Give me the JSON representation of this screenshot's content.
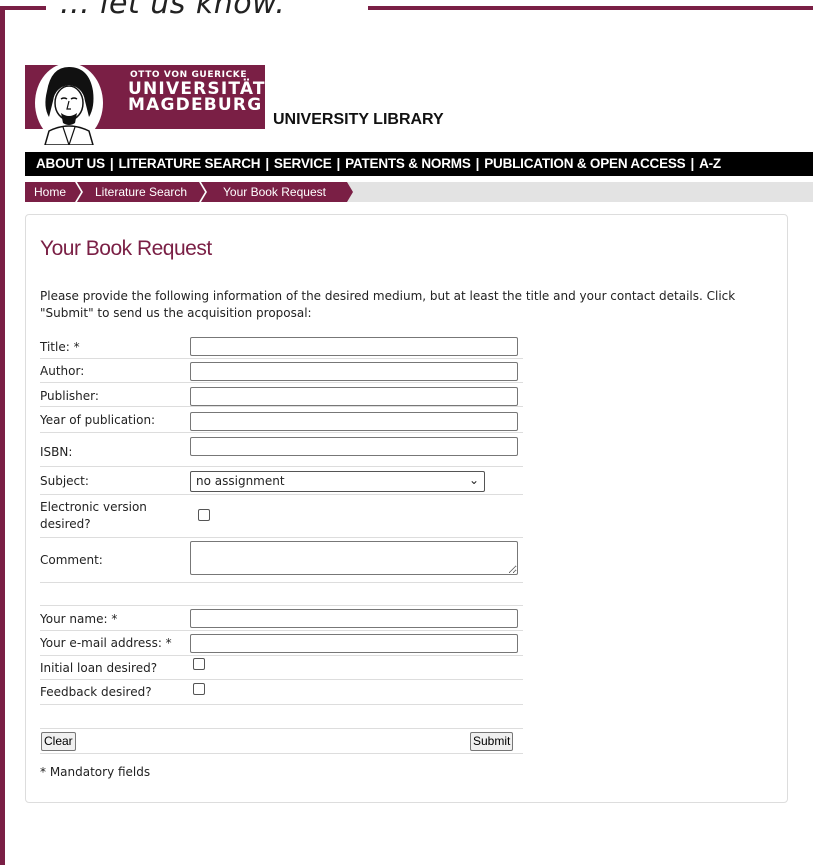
{
  "caption": "... let us know.",
  "logo": {
    "line1": "OTTO VON GUERICKE",
    "line2": "UNIVERSITÄT",
    "line3": "MAGDEBURG"
  },
  "library_title": "UNIVERSITY LIBRARY",
  "nav": [
    "ABOUT US",
    "LITERATURE SEARCH",
    "SERVICE",
    "PATENTS & NORMS",
    "PUBLICATION & OPEN ACCESS",
    "A-Z"
  ],
  "nav_separator": "|",
  "breadcrumb": [
    "Home",
    "Literature Search",
    "Your Book Request"
  ],
  "page_title": "Your Book Request",
  "intro": "Please provide the following information of the desired medium, but at least the title and your contact details. Click \"Submit\" to send us the acquisition proposal:",
  "form": {
    "title_label": "Title: *",
    "title_value": "",
    "author_label": "Author:",
    "author_value": "",
    "publisher_label": "Publisher:",
    "publisher_value": "",
    "year_label": "Year of publication:",
    "year_value": "",
    "isbn_label": "ISBN:",
    "isbn_value": "",
    "subject_label": "Subject:",
    "subject_value": "no assignment",
    "electronic_label": "Electronic version desired?",
    "electronic_checked": false,
    "comment_label": "Comment:",
    "comment_value": "",
    "name_label": "Your name: *",
    "name_value": "",
    "email_label": "Your e-mail address: *",
    "email_value": "",
    "initial_loan_label": "Initial loan desired?",
    "initial_loan_checked": false,
    "feedback_label": "Feedback desired?",
    "feedback_checked": false,
    "clear_label": "Clear",
    "submit_label": "Submit"
  },
  "mandatory_note": "* Mandatory fields",
  "colors": {
    "brand": "#7a1f45",
    "nav_bg": "#000000",
    "crumb_bg": "#e3e3e3"
  }
}
